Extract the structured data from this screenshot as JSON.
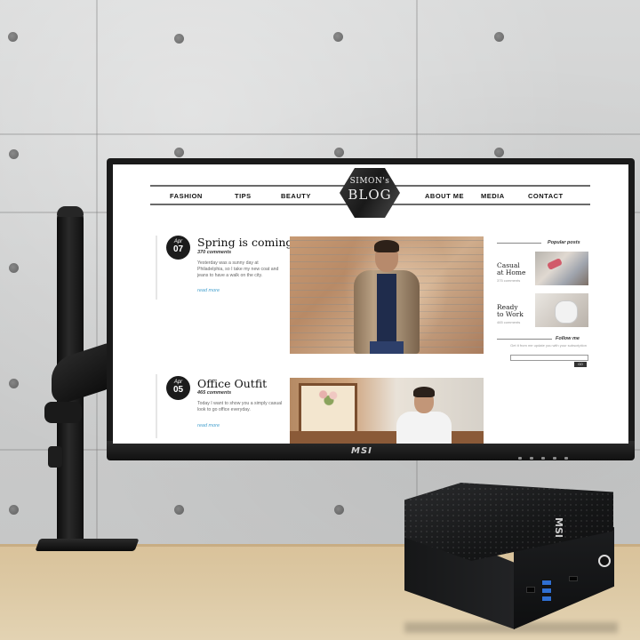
{
  "blog": {
    "nav_left": [
      "FASHION",
      "TIPS",
      "BEAUTY"
    ],
    "nav_right": [
      "ABOUT ME",
      "MEDIA",
      "CONTACT"
    ],
    "logo_line1": "SIMON's",
    "logo_line2": "BLOG",
    "posts": [
      {
        "month": "Apr",
        "day": "07",
        "title": "Spring is coming!",
        "comments": "370 comments",
        "excerpt": "Yesterday was a sunny day at Philadelphia, so I take my new coat and jeans to have a walk on the city.",
        "read_more": "read more"
      },
      {
        "month": "Apr",
        "day": "05",
        "title": "Office Outfit",
        "comments": "465 comments",
        "excerpt": "Today I want to show you a simply casual look to go office everyday.",
        "read_more": "read more"
      }
    ],
    "sidebar": {
      "popular_heading": "Popular posts",
      "popular": [
        {
          "line1": "Casual",
          "line2": "at Home",
          "sub": "375 comments"
        },
        {
          "line1": "Ready",
          "line2": "to Work",
          "sub": "465 comments"
        }
      ],
      "follow_heading": "Follow me",
      "follow_text": "Get it from me update you with your subscription",
      "submit_label": "GO"
    }
  },
  "monitor": {
    "brand": "MSI"
  },
  "pc": {
    "brand": "MSI"
  }
}
